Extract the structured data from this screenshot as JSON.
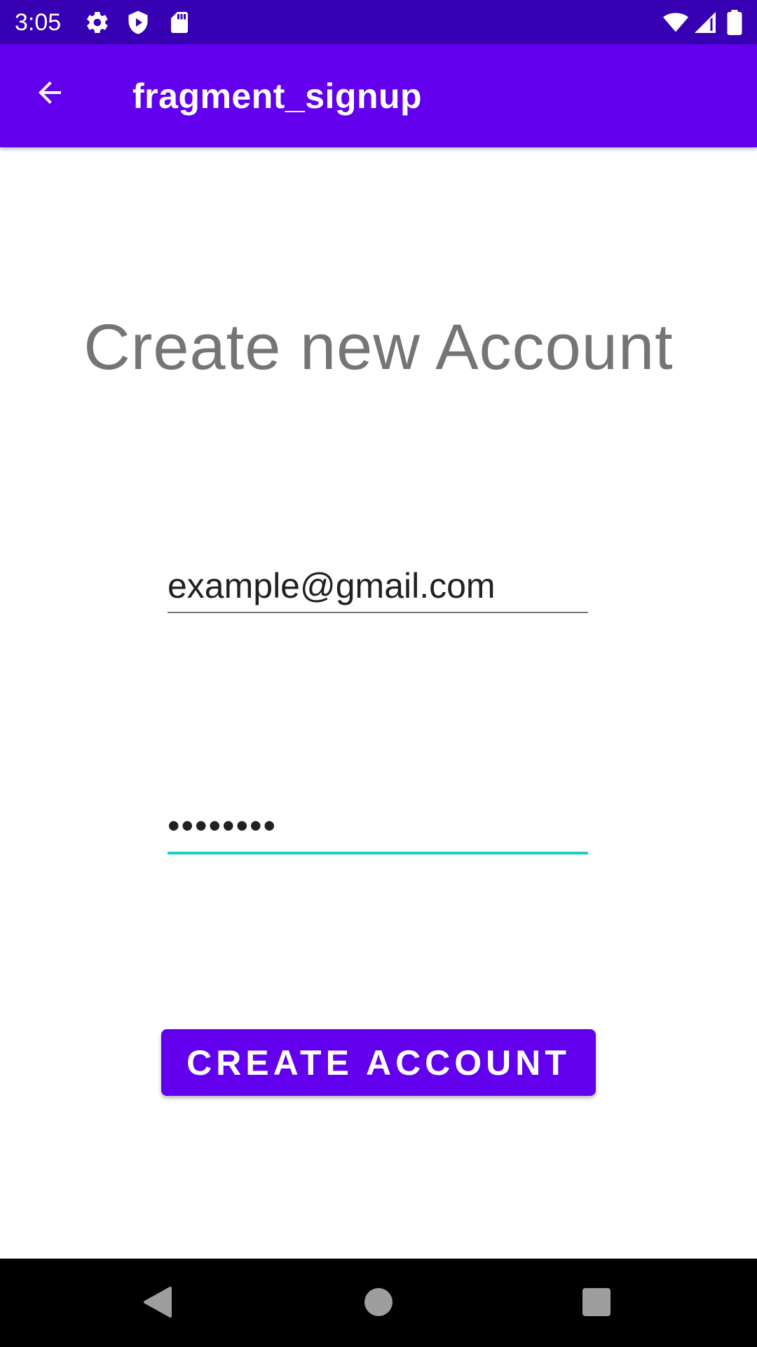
{
  "status_bar": {
    "time": "3:05",
    "icons": [
      "settings-icon",
      "shield-play-icon",
      "sd-card-icon",
      "wifi-icon",
      "cellular-signal-icon",
      "battery-icon"
    ]
  },
  "app_bar": {
    "title": "fragment_signup",
    "back_icon": "arrow-back-icon",
    "color": "#6200ee"
  },
  "main": {
    "heading": "Create new Account",
    "email": {
      "value": "example@gmail.com"
    },
    "password": {
      "value": "••••••••",
      "focus_color": "#1ccfc0"
    },
    "create_button": {
      "label": "CREATE ACCOUNT",
      "color": "#6200ee"
    }
  },
  "nav_bar": {
    "icons": [
      "back-triangle-icon",
      "home-circle-icon",
      "recents-square-icon"
    ]
  }
}
